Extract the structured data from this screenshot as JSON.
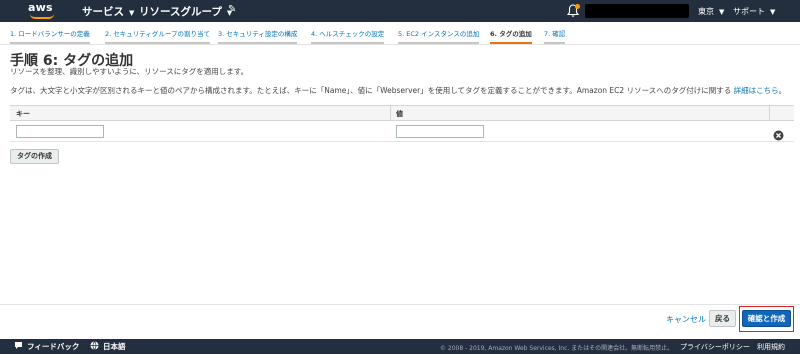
{
  "topnav": {
    "logo": "aws",
    "services": "サービス",
    "resource_groups": "リソースグループ",
    "region": "東京",
    "support": "サポート"
  },
  "steps": [
    "1. ロードバランサーの定義",
    "2. セキュリティグループの割り当て",
    "3. セキュリティ設定の構成",
    "4. ヘルスチェックの設定",
    "5. EC2 インスタンスの追加",
    "6. タグの追加",
    "7. 確認"
  ],
  "page": {
    "title": "手順 6: タグの追加",
    "subtitle": "リソースを整理、識別しやすいように、リソースにタグを適用します。",
    "description": "タグは、大文字と小文字が区別されるキーと値のペアから構成されます。たとえば、キーに「Name」、値に「Webserver」を使用してタグを定義することができます。Amazon EC2 リソースへのタグ付けに関する",
    "details_link": "詳細はこちら",
    "description_end": "。"
  },
  "table": {
    "columns": [
      "キー",
      "値"
    ],
    "rows": [
      {
        "key": "",
        "value": ""
      }
    ]
  },
  "create_tag_button": "タグの作成",
  "actions": {
    "cancel": "キャンセル",
    "back": "戻る",
    "review_and_create": "確認と作成"
  },
  "footer": {
    "feedback": "フィードバック",
    "language": "日本語",
    "copyright": "© 2008 - 2019, Amazon Web Services, Inc. またはその関連会社。無断転用禁止。",
    "privacy": "プライバシーポリシー",
    "terms": "利用規約"
  },
  "colors": {
    "nav_bg": "#232f3e",
    "accent": "#ff9900",
    "link": "#0073bb",
    "primary_button": "#1166bb",
    "highlight": "#e02020"
  }
}
